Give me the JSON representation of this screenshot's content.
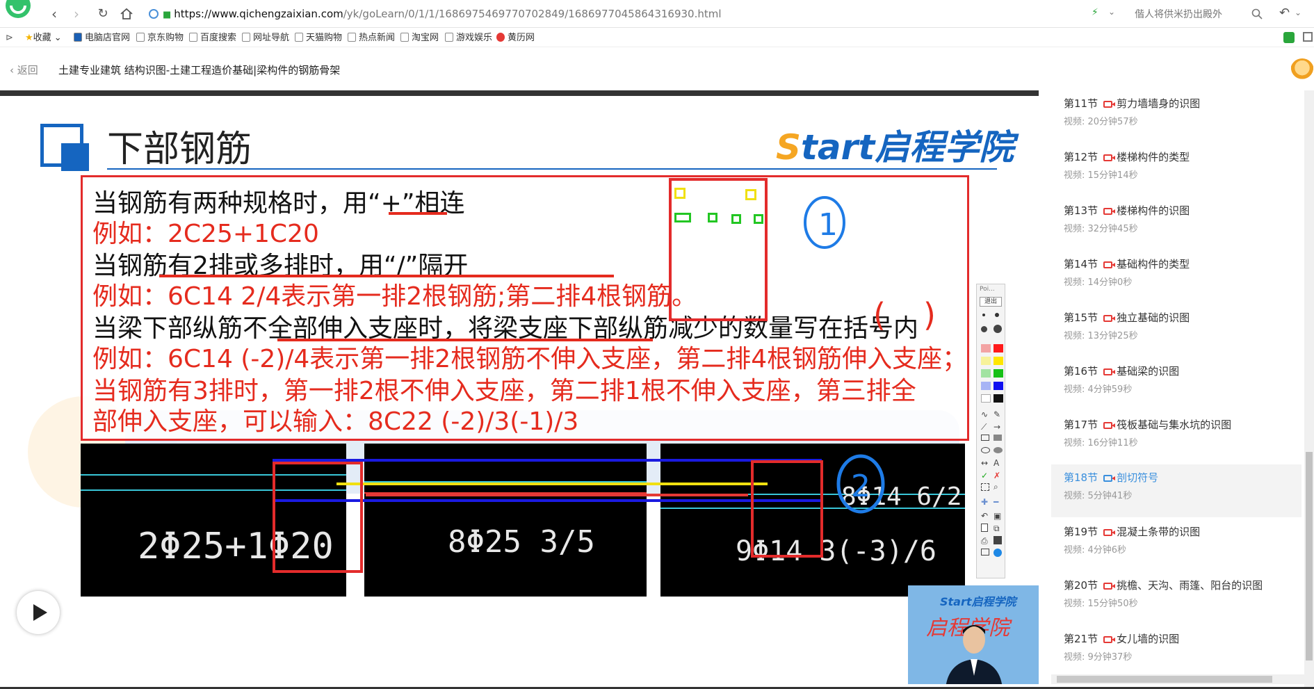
{
  "browser": {
    "url_host": "https://www.qichengzaixian.com",
    "url_path": "/yk/goLearn/0/1/1/1686975469770702849/1686977045864316930.html",
    "search_hint": "偕人将供米扔出殿外"
  },
  "bookmarks": [
    {
      "label": "收藏"
    },
    {
      "label": "电脑店官网"
    },
    {
      "label": "京东购物"
    },
    {
      "label": "百度搜索"
    },
    {
      "label": "网址导航"
    },
    {
      "label": "天猫购物"
    },
    {
      "label": "热点新闻"
    },
    {
      "label": "淘宝网"
    },
    {
      "label": "游戏娱乐"
    },
    {
      "label": "黄历网"
    }
  ],
  "header": {
    "back_label": "返回",
    "course_title": "土建专业建筑 结构识图-土建工程造价基础|梁构件的钢筋骨架"
  },
  "slide": {
    "title": "下部钢筋",
    "brand_s": "S",
    "brand_rest": "tart启程学院",
    "lines": [
      {
        "text": "当钢筋有两种规格时，用“+”相连",
        "color": "black"
      },
      {
        "text": "例如：2C25+1C20",
        "color": "red"
      },
      {
        "text": "当钢筋有2排或多排时，用“/”隔开",
        "color": "black"
      },
      {
        "text": "例如：6C14 2/4表示第一排2根钢筋;第二排4根钢筋。",
        "color": "red"
      },
      {
        "text": "当梁下部纵筋不全部伸入支座时，将梁支座下部纵筋减少的数量写在括号内",
        "color": "black"
      },
      {
        "text": "例如：6C14 (-2)/4表示第一排2根钢筋不伸入支座，第二排4根钢筋伸入支座；",
        "color": "red"
      },
      {
        "text": "当钢筋有3排时，第一排2根不伸入支座，第二排1根不伸入支座，第三排全",
        "color": "red"
      },
      {
        "text": "部伸入支座，可以输入：8C22 (-2)/3(-1)/3",
        "color": "red"
      }
    ],
    "cad_labels": {
      "panel1": "2Φ25+1Φ20",
      "panel2": "8Φ25 3/5",
      "panel3_top": "8Φ14 6/2",
      "panel3_bottom": "9Φ14 3(-3)/6"
    },
    "annotations": {
      "circle1": "1",
      "circle2": "2"
    },
    "toolbar_header": "Poi...",
    "toolbar_exit": "退出"
  },
  "teacher": {
    "brand": "Start启程学院",
    "chinese": "启程学院"
  },
  "lessons": [
    {
      "num": "第11节",
      "title": "剪力墙墙身的识图",
      "meta": "视频: 20分钟57秒",
      "active": false
    },
    {
      "num": "第12节",
      "title": "楼梯构件的类型",
      "meta": "视频: 15分钟14秒",
      "active": false
    },
    {
      "num": "第13节",
      "title": "楼梯构件的识图",
      "meta": "视频: 32分钟45秒",
      "active": false
    },
    {
      "num": "第14节",
      "title": "基础构件的类型",
      "meta": "视频: 14分钟0秒",
      "active": false
    },
    {
      "num": "第15节",
      "title": "独立基础的识图",
      "meta": "视频: 13分钟25秒",
      "active": false
    },
    {
      "num": "第16节",
      "title": "基础梁的识图",
      "meta": "视频: 4分钟59秒",
      "active": false
    },
    {
      "num": "第17节",
      "title": "筏板基础与集水坑的识图",
      "meta": "视频: 16分钟11秒",
      "active": false
    },
    {
      "num": "第18节",
      "title": "剖切符号",
      "meta": "视频: 5分钟41秒",
      "active": true
    },
    {
      "num": "第19节",
      "title": "混凝土条带的识图",
      "meta": "视频: 4分钟6秒",
      "active": false
    },
    {
      "num": "第20节",
      "title": "挑檐、天沟、雨篷、阳台的识图",
      "meta": "视频: 15分钟50秒",
      "active": false
    },
    {
      "num": "第21节",
      "title": "女儿墙的识图",
      "meta": "视频: 9分钟37秒",
      "active": false
    }
  ]
}
